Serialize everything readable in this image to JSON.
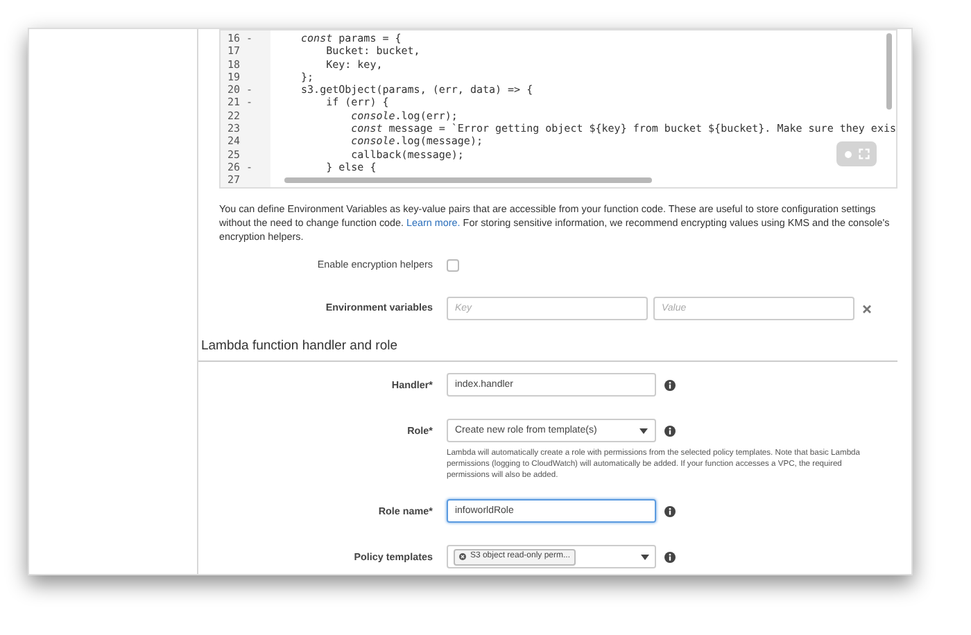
{
  "code_editor": {
    "lines": [
      {
        "gutter": "16 -",
        "text": "    *const* params = {"
      },
      {
        "gutter": "17",
        "text": "        Bucket: bucket,"
      },
      {
        "gutter": "18",
        "text": "        Key: key,"
      },
      {
        "gutter": "19",
        "text": "    };"
      },
      {
        "gutter": "20 -",
        "text": "    s3.getObject(params, (err, data) => {"
      },
      {
        "gutter": "21 -",
        "text": "        if (err) {"
      },
      {
        "gutter": "22",
        "text": "            *console*.log(err);"
      },
      {
        "gutter": "23",
        "text": "            *const* message = `Error getting object ${key} from bucket ${bucket}. Make sure they exis"
      },
      {
        "gutter": "24",
        "text": "            *console*.log(message);"
      },
      {
        "gutter": "25",
        "text": "            callback(message);"
      },
      {
        "gutter": "26 -",
        "text": "        } else {"
      },
      {
        "gutter": "27"
      }
    ]
  },
  "description": {
    "before": "You can define Environment Variables as key-value pairs that are accessible from your function code. These are useful to store configuration settings without the need to change function code.",
    "link": "Learn more.",
    "after": "For storing sensitive information, we recommend encrypting values using KMS and the console's encryption helpers."
  },
  "encryption": {
    "label": "Enable encryption helpers",
    "checked": false
  },
  "env_vars": {
    "label": "Environment variables",
    "key_placeholder": "Key",
    "value_placeholder": "Value"
  },
  "section_title": "Lambda function handler and role",
  "fields": [
    {
      "kind": "input",
      "label": "Handler*",
      "value": "index.handler",
      "focused": false
    },
    {
      "kind": "select",
      "label": "Role*",
      "value": "Create new role from template(s)",
      "help": "Lambda will automatically create a role with permissions from the selected policy templates. Note that basic Lambda permissions (logging to CloudWatch) will automatically be added. If your function accesses a VPC, the required permissions will also be added."
    },
    {
      "kind": "input",
      "label": "Role name*",
      "value": "infoworldRole",
      "focused": true
    },
    {
      "kind": "multiselect",
      "label": "Policy templates",
      "chips": [
        "S3 object read-only perm..."
      ]
    }
  ]
}
